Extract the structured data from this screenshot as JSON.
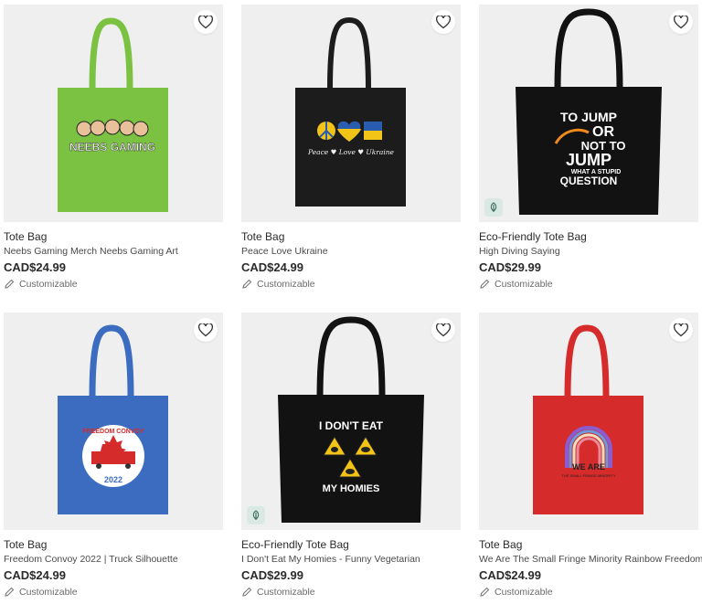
{
  "products": [
    {
      "type": "Tote Bag",
      "title": "Neebs Gaming Merch Neebs Gaming Art",
      "price": "CAD$24.99",
      "customizable": "Customizable",
      "bag_color": "#7cc242",
      "eco": false,
      "design_text": [
        "NEEBS GAMING"
      ]
    },
    {
      "type": "Tote Bag",
      "title": "Peace Love Ukraine",
      "price": "CAD$24.99",
      "customizable": "Customizable",
      "bag_color": "#1c1c1c",
      "eco": false,
      "design_text": [
        "Peace ♥ Love ♥ Ukraine"
      ]
    },
    {
      "type": "Eco-Friendly Tote Bag",
      "title": "High Diving Saying",
      "price": "CAD$29.99",
      "customizable": "Customizable",
      "bag_color": "#121212",
      "eco": true,
      "design_text": [
        "TO JUMP",
        "OR",
        "NOT TO",
        "JUMP",
        "WHAT A STUPID",
        "QUESTION"
      ]
    },
    {
      "type": "Tote Bag",
      "title": "Freedom Convoy 2022 | Truck Silhouette",
      "price": "CAD$24.99",
      "customizable": "Customizable",
      "bag_color": "#3b6cc0",
      "eco": false,
      "design_text": [
        "FREEDOM CONVOY",
        "2022"
      ]
    },
    {
      "type": "Eco-Friendly Tote Bag",
      "title": "I Don't Eat My Homies - Funny Vegetarian",
      "price": "CAD$29.99",
      "customizable": "Customizable",
      "bag_color": "#121212",
      "eco": true,
      "design_text": [
        "I DON'T EAT",
        "MY HOMIES"
      ]
    },
    {
      "type": "Tote Bag",
      "title": "We Are The Small Fringe Minority Rainbow Freedom",
      "price": "CAD$24.99",
      "customizable": "Customizable",
      "bag_color": "#d62b2b",
      "eco": false,
      "design_text": [
        "WE ARE",
        "THE SMALL FRINGE MINORITY"
      ]
    }
  ],
  "icons": {
    "favorite": "heart-outline-icon",
    "eco": "leaf-icon",
    "customize": "pencil-icon"
  }
}
